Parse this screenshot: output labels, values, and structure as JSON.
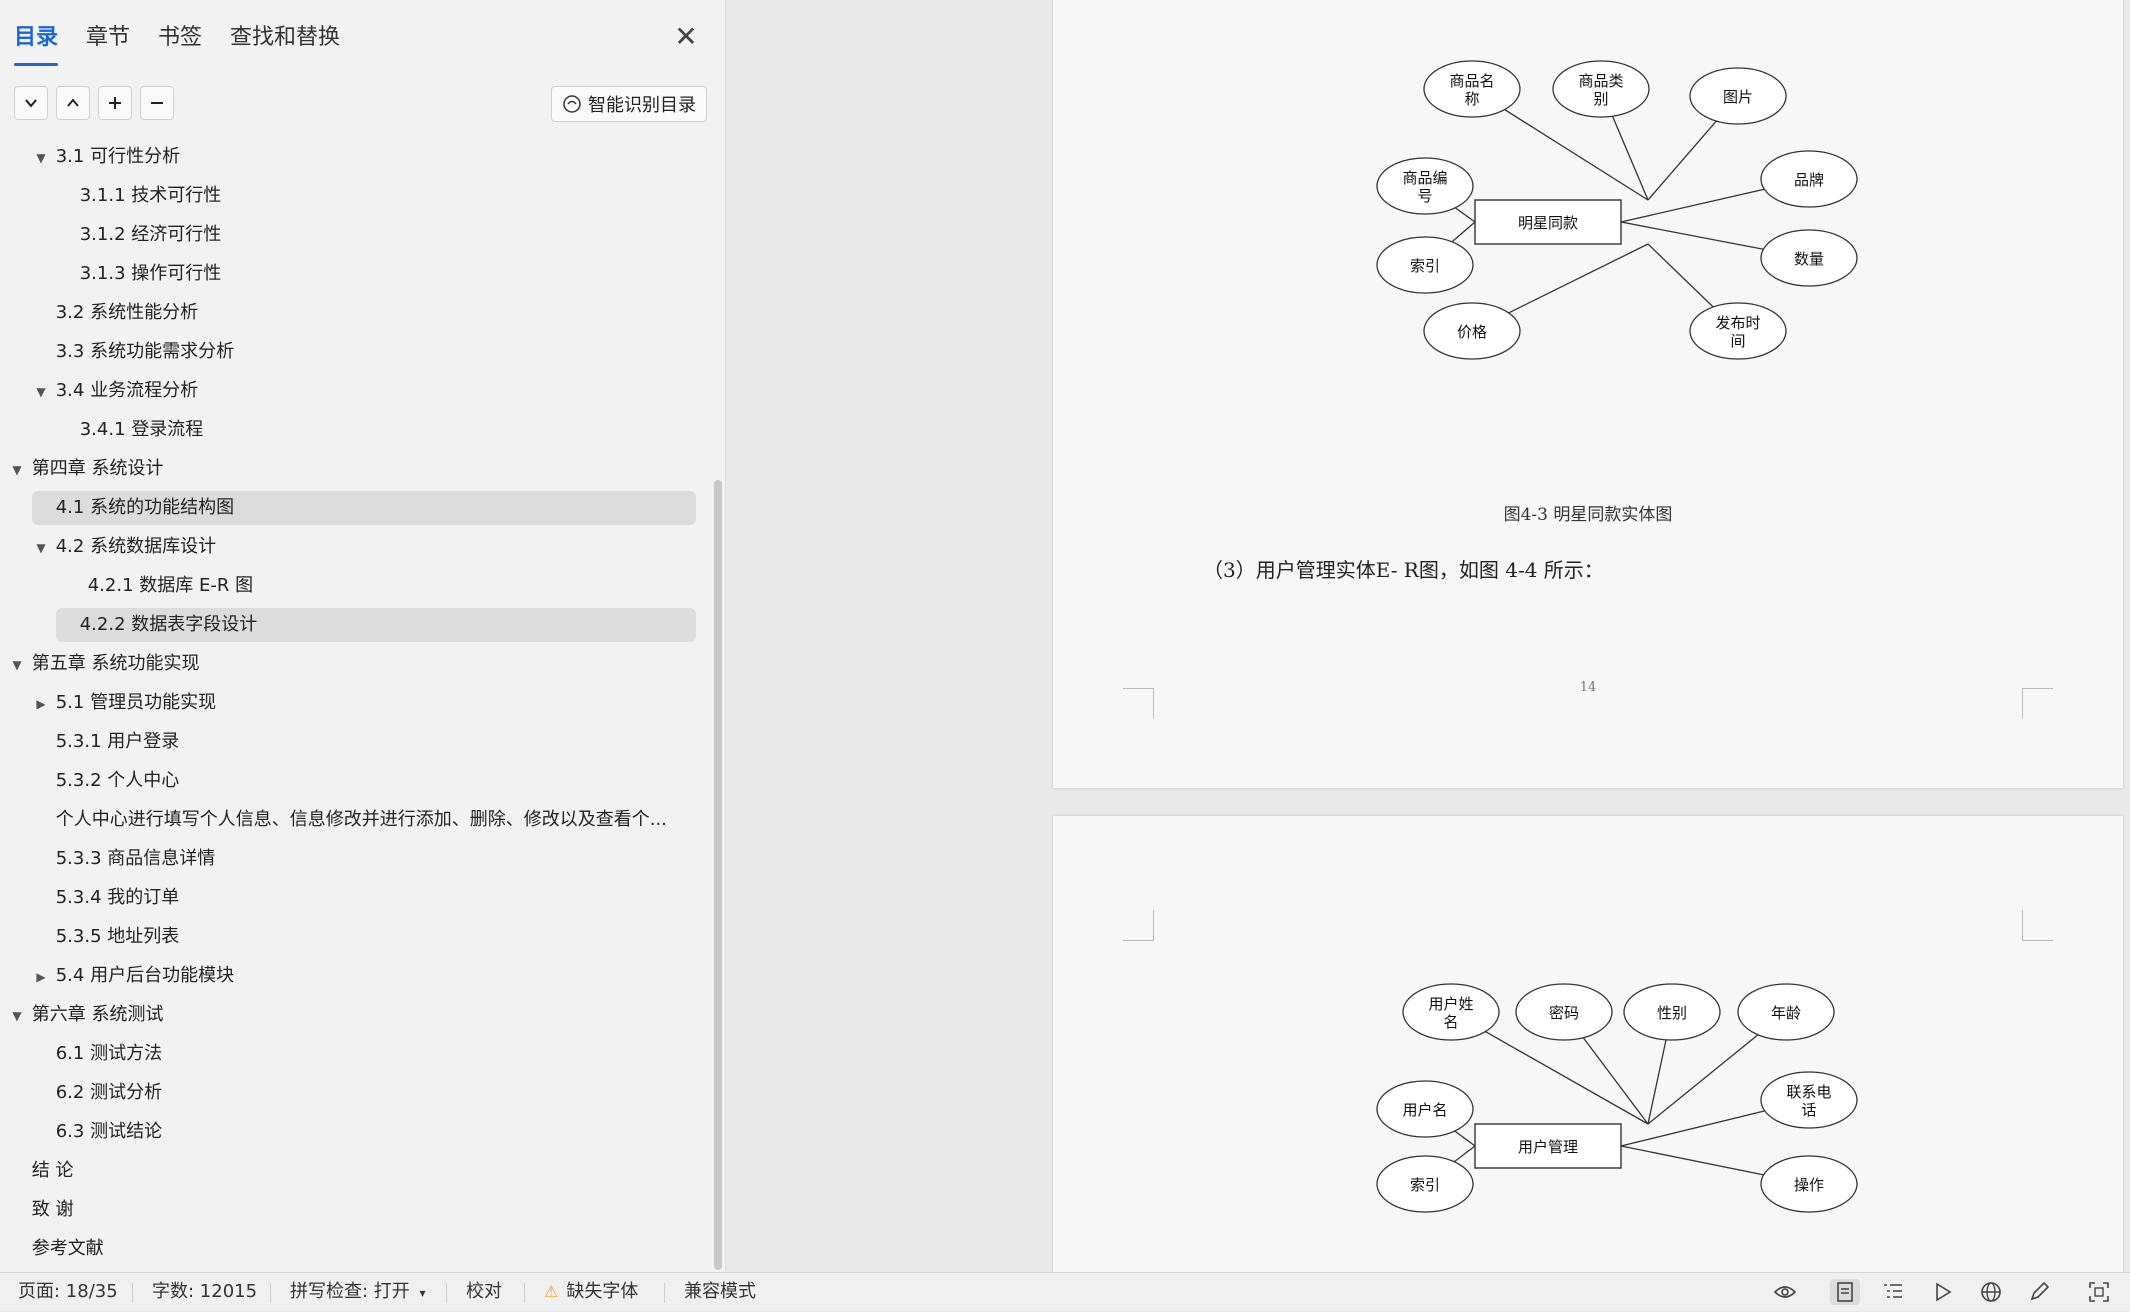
{
  "sidebar": {
    "tabs": [
      "目录",
      "章节",
      "书签",
      "查找和替换"
    ],
    "smart_button": "智能识别目录",
    "toc": [
      {
        "label": "3.1  可行性分析",
        "caret": "down"
      },
      {
        "label": "3.1.1    技术可行性",
        "caret": ""
      },
      {
        "label": "3.1.2  经济可行性",
        "caret": ""
      },
      {
        "label": "3.1.3  操作可行性",
        "caret": ""
      },
      {
        "label": "3.2  系统性能分析",
        "caret": ""
      },
      {
        "label": "3.3  系统功能需求分析",
        "caret": ""
      },
      {
        "label": "3.4  业务流程分析",
        "caret": "down"
      },
      {
        "label": "3.4.1 登录流程",
        "caret": ""
      },
      {
        "label": "第四章  系统设计",
        "caret": "down"
      },
      {
        "label": "4.1  系统的功能结构图",
        "caret": ""
      },
      {
        "label": "4.2  系统数据库设计",
        "caret": "down"
      },
      {
        "label": "4.2.1    数据库 E-R 图",
        "caret": ""
      },
      {
        "label": "4.2.2    数据表字段设计",
        "caret": ""
      },
      {
        "label": "第五章  系统功能实现",
        "caret": "down"
      },
      {
        "label": "5.1 管理员功能实现",
        "caret": "right"
      },
      {
        "label": "5.3.1 用户登录",
        "caret": ""
      },
      {
        "label": "5.3.2 个人中心",
        "caret": ""
      },
      {
        "label": "个人中心进行填写个人信息、信息修改并进行添加、删除、修改以及查看个...",
        "caret": ""
      },
      {
        "label": "5.3.3 商品信息详情",
        "caret": ""
      },
      {
        "label": "5.3.4 我的订单",
        "caret": ""
      },
      {
        "label": "5.3.5 地址列表",
        "caret": ""
      },
      {
        "label": "5.4 用户后台功能模块",
        "caret": "right"
      },
      {
        "label": "第六章  系统测试",
        "caret": "down"
      },
      {
        "label": "6.1  测试方法",
        "caret": ""
      },
      {
        "label": "6.2  测试分析",
        "caret": ""
      },
      {
        "label": "6.3  测试结论",
        "caret": ""
      },
      {
        "label": "结  论",
        "caret": ""
      },
      {
        "label": "致  谢",
        "caret": ""
      },
      {
        "label": "参考文献",
        "caret": ""
      }
    ]
  },
  "doc": {
    "diagram1": {
      "center": "明星同款",
      "attributes": [
        "商品名称",
        "商品类别",
        "图片",
        "商品编号",
        "品牌",
        "索引",
        "数量",
        "价格",
        "发布时间"
      ]
    },
    "caption": "图4-3  明星同款实体图",
    "paragraph": "（3）用户管理实体E- R图，如图 4-4 所示：",
    "page_number": "14",
    "diagram2": {
      "center": "用户管理",
      "attributes": [
        "用户姓名",
        "密码",
        "性别",
        "年龄",
        "用户名",
        "联系电话",
        "索引",
        "操作"
      ]
    }
  },
  "status": {
    "page": "页面: 18/35",
    "words": "字数: 12015",
    "spell": "拼写检查: 打开",
    "proof": "校对",
    "missing_font": "缺失字体",
    "compat": "兼容模式"
  }
}
